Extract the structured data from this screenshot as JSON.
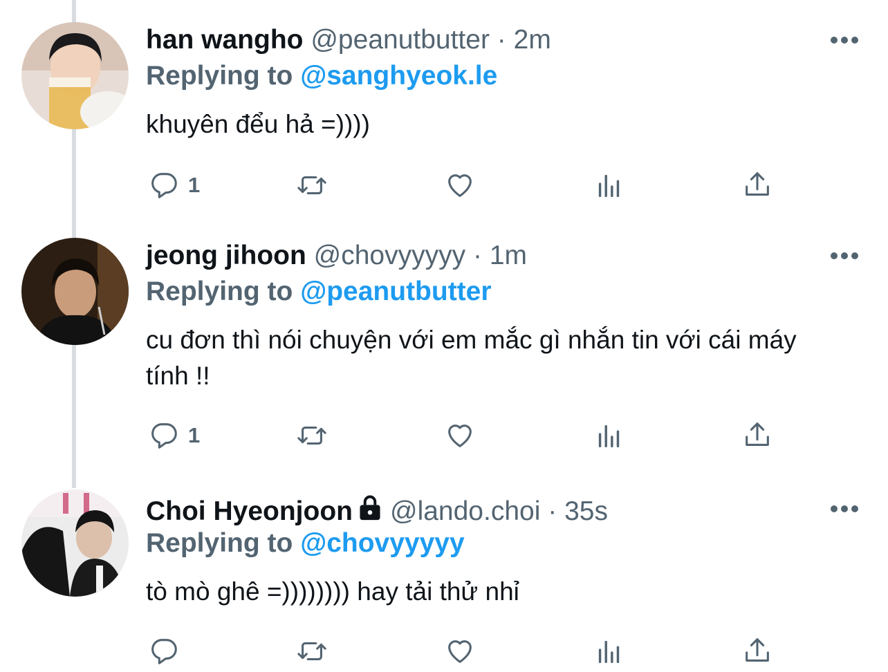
{
  "tweets": [
    {
      "name": "han wangho",
      "handle": "@peanutbutter",
      "separator": "·",
      "time": "2m",
      "replying_label": "Replying to",
      "replying_to": "@sanghyeok.le",
      "text": "khuyên đểu hả =))))",
      "reply_count": "1",
      "locked": false
    },
    {
      "name": "jeong jihoon",
      "handle": "@chovyyyyy",
      "separator": "·",
      "time": "1m",
      "replying_label": "Replying to",
      "replying_to": "@peanutbutter",
      "text": "cu đơn thì nói chuyện với em mắc gì nhắn tin với cái máy tính !!",
      "reply_count": "1",
      "locked": false
    },
    {
      "name": "Choi Hyeonjoon",
      "handle": "@lando.choi",
      "separator": "·",
      "time": "35s",
      "replying_label": "Replying to",
      "replying_to": "@chovyyyyy",
      "text": "tò mò ghê =)))))))) hay tải thử nhỉ",
      "reply_count": "",
      "locked": true
    }
  ],
  "icons": [
    "reply-icon",
    "retweet-icon",
    "like-icon",
    "views-icon",
    "share-icon",
    "more-icon",
    "lock-icon"
  ],
  "colors": {
    "link": "#1d9bf0",
    "secondary_text": "#536471",
    "primary_text": "#0f1419",
    "thread_line": "#d9dde1"
  }
}
